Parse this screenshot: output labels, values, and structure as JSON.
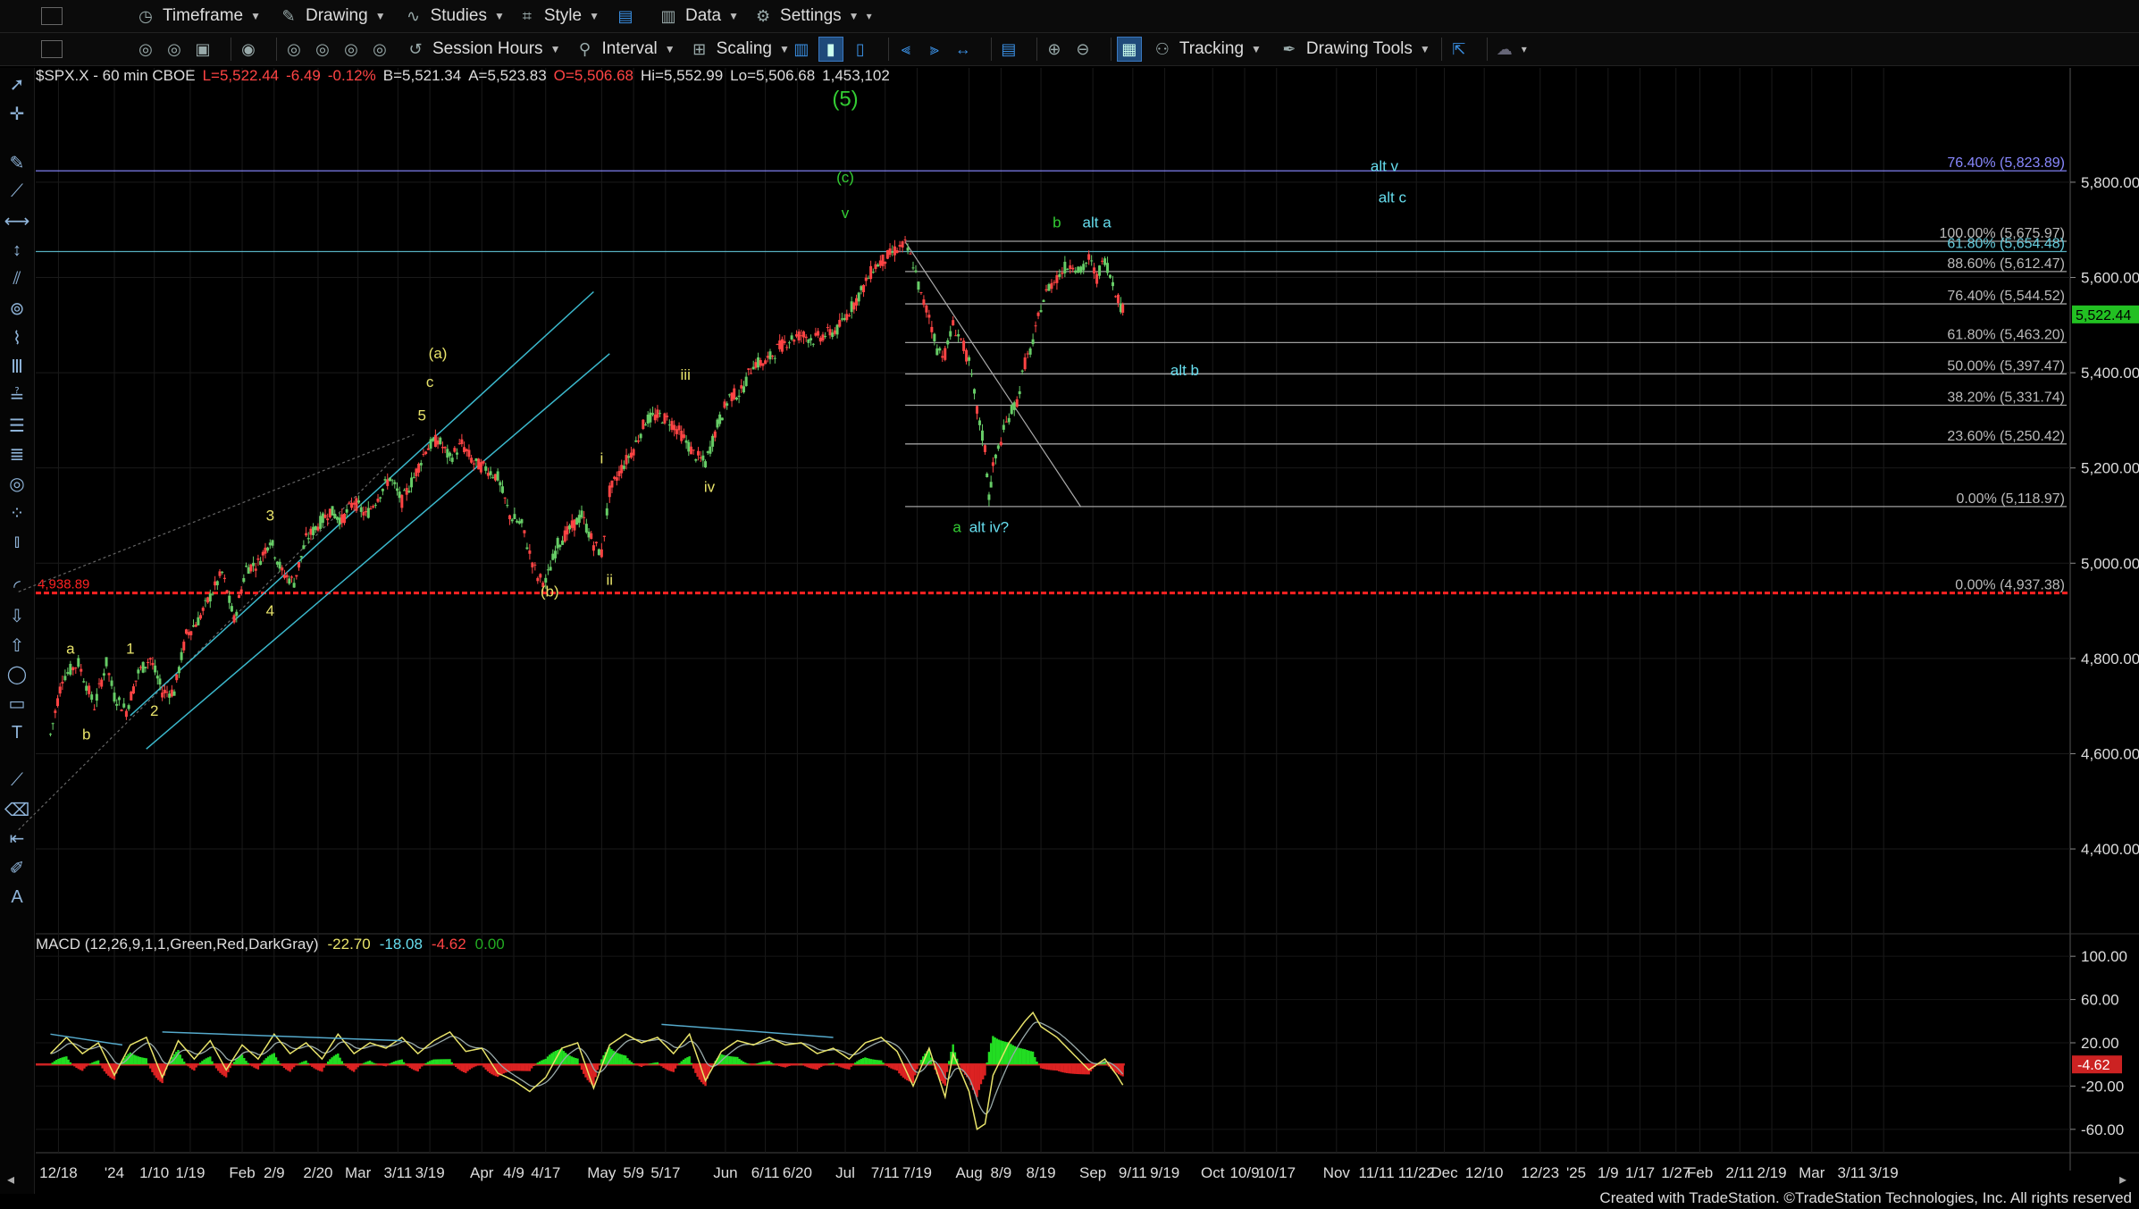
{
  "toolbar": {
    "timeframe": "Timeframe",
    "drawing": "Drawing",
    "studies": "Studies",
    "style": "Style",
    "data": "Data",
    "settings": "Settings",
    "session_hours": "Session Hours",
    "interval": "Interval",
    "scaling": "Scaling",
    "tracking": "Tracking",
    "drawing_tools": "Drawing Tools"
  },
  "colors": {
    "background": "#000000",
    "candle_up": "#66cc66",
    "candle_down": "#ff4444",
    "wave_yellow": "#e8e36a",
    "wave_green": "#33cc33",
    "wave_cyan": "#66ddee",
    "support_red": "#ff2222",
    "fib_gray": "#bbbbbb",
    "price_badge": "#22c022",
    "macd_pos": "#22dd22",
    "macd_neg": "#dd2222"
  },
  "chart_data": [
    {
      "type": "candlestick",
      "header": {
        "symbol": "$SPX.X - 60 min  CBOE",
        "last": "L=5,522.44",
        "change": "-6.49",
        "change_pct": "-0.12%",
        "bid": "B=5,521.34",
        "ask": "A=5,523.83",
        "open": "O=5,506.68",
        "high": "Hi=5,552.99",
        "low": "Lo=5,506.68",
        "volume": "1,453,102"
      },
      "y_ticks": [
        {
          "value": 5800,
          "label": "5,800.00"
        },
        {
          "value": 5600,
          "label": "5,600.00"
        },
        {
          "value": 5400,
          "label": "5,400.00"
        },
        {
          "value": 5200,
          "label": "5,200.00"
        },
        {
          "value": 5000,
          "label": "5,000.00"
        },
        {
          "value": 4800,
          "label": "4,800.00"
        },
        {
          "value": 4600,
          "label": "4,600.00"
        },
        {
          "value": 4400,
          "label": "4,400.00"
        }
      ],
      "ylim": [
        4250,
        6040
      ],
      "x_ticks": [
        {
          "d": -14,
          "label": "12/18"
        },
        {
          "d": 0,
          "label": "'24"
        },
        {
          "d": 10,
          "label": "1/10"
        },
        {
          "d": 19,
          "label": "1/19"
        },
        {
          "d": 32,
          "label": "Feb"
        },
        {
          "d": 40,
          "label": "2/9"
        },
        {
          "d": 51,
          "label": "2/20"
        },
        {
          "d": 61,
          "label": "Mar"
        },
        {
          "d": 71,
          "label": "3/11"
        },
        {
          "d": 79,
          "label": "3/19"
        },
        {
          "d": 92,
          "label": "Apr"
        },
        {
          "d": 100,
          "label": "4/9"
        },
        {
          "d": 108,
          "label": "4/17"
        },
        {
          "d": 122,
          "label": "May"
        },
        {
          "d": 130,
          "label": "5/9"
        },
        {
          "d": 138,
          "label": "5/17"
        },
        {
          "d": 153,
          "label": "Jun"
        },
        {
          "d": 163,
          "label": "6/11"
        },
        {
          "d": 171,
          "label": "6/20"
        },
        {
          "d": 183,
          "label": "Jul"
        },
        {
          "d": 193,
          "label": "7/11"
        },
        {
          "d": 201,
          "label": "7/19"
        },
        {
          "d": 214,
          "label": "Aug"
        },
        {
          "d": 222,
          "label": "8/9"
        },
        {
          "d": 232,
          "label": "8/19"
        },
        {
          "d": 245,
          "label": "Sep"
        },
        {
          "d": 255,
          "label": "9/11"
        },
        {
          "d": 263,
          "label": "9/19"
        },
        {
          "d": 275,
          "label": "Oct"
        },
        {
          "d": 283,
          "label": "10/9"
        },
        {
          "d": 291,
          "label": "10/17"
        },
        {
          "d": 306,
          "label": "Nov"
        },
        {
          "d": 316,
          "label": "11/11"
        },
        {
          "d": 326,
          "label": "11/22"
        },
        {
          "d": 333,
          "label": "Dec"
        },
        {
          "d": 343,
          "label": "12/10"
        },
        {
          "d": 357,
          "label": "12/23"
        },
        {
          "d": 366,
          "label": "'25"
        },
        {
          "d": 374,
          "label": "1/9"
        },
        {
          "d": 382,
          "label": "1/17"
        },
        {
          "d": 391,
          "label": "1/27"
        },
        {
          "d": 397,
          "label": "Feb"
        },
        {
          "d": 407,
          "label": "2/11"
        },
        {
          "d": 415,
          "label": "2/19"
        },
        {
          "d": 425,
          "label": "Mar"
        },
        {
          "d": 435,
          "label": "3/11"
        },
        {
          "d": 443,
          "label": "3/19"
        }
      ],
      "price_path": [
        [
          -16,
          4640
        ],
        [
          -13,
          4760
        ],
        [
          -9,
          4790
        ],
        [
          -5,
          4700
        ],
        [
          -2,
          4790
        ],
        [
          0,
          4720
        ],
        [
          3,
          4690
        ],
        [
          6,
          4770
        ],
        [
          9,
          4800
        ],
        [
          12,
          4730
        ],
        [
          15,
          4730
        ],
        [
          18,
          4850
        ],
        [
          21,
          4880
        ],
        [
          24,
          4930
        ],
        [
          27,
          4980
        ],
        [
          30,
          4880
        ],
        [
          33,
          4990
        ],
        [
          36,
          5000
        ],
        [
          39,
          5050
        ],
        [
          42,
          4980
        ],
        [
          45,
          4960
        ],
        [
          48,
          5050
        ],
        [
          51,
          5080
        ],
        [
          54,
          5110
        ],
        [
          57,
          5090
        ],
        [
          60,
          5130
        ],
        [
          63,
          5100
        ],
        [
          66,
          5140
        ],
        [
          69,
          5180
        ],
        [
          72,
          5130
        ],
        [
          75,
          5180
        ],
        [
          78,
          5240
        ],
        [
          81,
          5260
        ],
        [
          84,
          5220
        ],
        [
          87,
          5250
        ],
        [
          90,
          5210
        ],
        [
          93,
          5200
        ],
        [
          96,
          5180
        ],
        [
          99,
          5100
        ],
        [
          102,
          5080
        ],
        [
          104,
          5020
        ],
        [
          106,
          4970
        ],
        [
          108,
          4960
        ],
        [
          111,
          5040
        ],
        [
          114,
          5070
        ],
        [
          117,
          5100
        ],
        [
          120,
          5040
        ],
        [
          122,
          5020
        ],
        [
          124,
          5150
        ],
        [
          127,
          5200
        ],
        [
          130,
          5240
        ],
        [
          133,
          5300
        ],
        [
          136,
          5310
        ],
        [
          139,
          5300
        ],
        [
          142,
          5270
        ],
        [
          145,
          5230
        ],
        [
          148,
          5210
        ],
        [
          151,
          5290
        ],
        [
          154,
          5350
        ],
        [
          157,
          5360
        ],
        [
          160,
          5420
        ],
        [
          163,
          5420
        ],
        [
          166,
          5450
        ],
        [
          169,
          5470
        ],
        [
          172,
          5480
        ],
        [
          175,
          5470
        ],
        [
          178,
          5480
        ],
        [
          181,
          5490
        ],
        [
          184,
          5530
        ],
        [
          187,
          5570
        ],
        [
          190,
          5620
        ],
        [
          193,
          5640
        ],
        [
          196,
          5660
        ],
        [
          198,
          5668
        ],
        [
          200,
          5630
        ],
        [
          202,
          5560
        ],
        [
          204,
          5520
        ],
        [
          206,
          5450
        ],
        [
          208,
          5440
        ],
        [
          210,
          5500
        ],
        [
          212,
          5470
        ],
        [
          214,
          5420
        ],
        [
          216,
          5320
        ],
        [
          218,
          5240
        ],
        [
          219,
          5140
        ],
        [
          220,
          5200
        ],
        [
          222,
          5260
        ],
        [
          224,
          5310
        ],
        [
          226,
          5340
        ],
        [
          228,
          5420
        ],
        [
          230,
          5460
        ],
        [
          232,
          5540
        ],
        [
          234,
          5580
        ],
        [
          236,
          5600
        ],
        [
          238,
          5620
        ],
        [
          240,
          5630
        ],
        [
          242,
          5610
        ],
        [
          244,
          5640
        ],
        [
          246,
          5600
        ],
        [
          248,
          5640
        ],
        [
          250,
          5590
        ],
        [
          252,
          5540
        ],
        [
          253,
          5522
        ]
      ],
      "current_price": {
        "value": 5522.44,
        "label": "5,522.44"
      },
      "support_line": {
        "value": 4937.38,
        "label": "4,938.89"
      },
      "fib_levels": [
        {
          "value": 5823.89,
          "label": "76.40% (5,823.89)",
          "color": "#8888ff"
        },
        {
          "value": 5675.97,
          "label": "100.00% (5,675.97)",
          "color": "#bbbbbb"
        },
        {
          "value": 5654.48,
          "label": "61.80% (5,654.48)",
          "color": "#66ccdd"
        },
        {
          "value": 5612.47,
          "label": "88.60% (5,612.47)",
          "color": "#bbbbbb"
        },
        {
          "value": 5544.52,
          "label": "76.40% (5,544.52)",
          "color": "#bbbbbb"
        },
        {
          "value": 5463.2,
          "label": "61.80% (5,463.20)",
          "color": "#bbbbbb"
        },
        {
          "value": 5397.47,
          "label": "50.00% (5,397.47)",
          "color": "#bbbbbb"
        },
        {
          "value": 5331.74,
          "label": "38.20% (5,331.74)",
          "color": "#bbbbbb"
        },
        {
          "value": 5250.42,
          "label": "23.60% (5,250.42)",
          "color": "#bbbbbb"
        },
        {
          "value": 5118.97,
          "label": "0.00% (5,118.97)",
          "color": "#bbbbbb"
        },
        {
          "value": 4937.38,
          "label": "0.00% (4,937.38)",
          "color": "#bbbbbb"
        }
      ],
      "wave_labels": [
        {
          "d": 183,
          "v": 5960,
          "text": "(5)",
          "color": "green",
          "big": true
        },
        {
          "d": 183,
          "v": 5800,
          "text": "(c)",
          "color": "green"
        },
        {
          "d": 183,
          "v": 5725,
          "text": "v",
          "color": "green"
        },
        {
          "d": 236,
          "v": 5705,
          "text": "b",
          "color": "green"
        },
        {
          "d": 211,
          "v": 5065,
          "text": "a",
          "color": "green"
        },
        {
          "d": 246,
          "v": 5705,
          "text": "alt a",
          "color": "cyan"
        },
        {
          "d": 318,
          "v": 5823,
          "text": "alt v",
          "color": "cyan"
        },
        {
          "d": 320,
          "v": 5758,
          "text": "alt c",
          "color": "cyan"
        },
        {
          "d": 268,
          "v": 5395,
          "text": "alt b",
          "color": "cyan"
        },
        {
          "d": 219,
          "v": 5065,
          "text": "alt iv?",
          "color": "cyan"
        },
        {
          "d": 81,
          "v": 5430,
          "text": "(a)",
          "color": "yellow"
        },
        {
          "d": 79,
          "v": 5370,
          "text": "c",
          "color": "yellow"
        },
        {
          "d": 77,
          "v": 5300,
          "text": "5",
          "color": "yellow"
        },
        {
          "d": 39,
          "v": 5090,
          "text": "3",
          "color": "yellow"
        },
        {
          "d": 39,
          "v": 4890,
          "text": "4",
          "color": "yellow"
        },
        {
          "d": 4,
          "v": 4810,
          "text": "1",
          "color": "yellow"
        },
        {
          "d": 10,
          "v": 4680,
          "text": "2",
          "color": "yellow"
        },
        {
          "d": -11,
          "v": 4810,
          "text": "a",
          "color": "yellow"
        },
        {
          "d": -7,
          "v": 4630,
          "text": "b",
          "color": "yellow"
        },
        {
          "d": 109,
          "v": 4930,
          "text": "(b)",
          "color": "yellow"
        },
        {
          "d": 122,
          "v": 5210,
          "text": "i",
          "color": "yellow"
        },
        {
          "d": 124,
          "v": 4955,
          "text": "ii",
          "color": "yellow"
        },
        {
          "d": 143,
          "v": 5385,
          "text": "iii",
          "color": "yellow"
        },
        {
          "d": 149,
          "v": 5150,
          "text": "iv",
          "color": "yellow"
        }
      ]
    },
    {
      "type": "line",
      "title": "MACD (12,26,9,1,1,Green,Red,DarkGray)",
      "readouts": [
        {
          "text": "-22.70",
          "color": "#e8e36a"
        },
        {
          "text": "-18.08",
          "color": "#66ddee"
        },
        {
          "text": "-4.62",
          "color": "#ff4444"
        },
        {
          "text": "0.00",
          "color": "#22aa22"
        }
      ],
      "y_ticks": [
        {
          "value": 100,
          "label": "100.00"
        },
        {
          "value": 60,
          "label": "60.00"
        },
        {
          "value": 20,
          "label": "20.00"
        },
        {
          "value": -20,
          "label": "-20.00"
        },
        {
          "value": -60,
          "label": "-60.00"
        }
      ],
      "ylim": [
        -75,
        115
      ],
      "current_value": {
        "value": 0,
        "label": "-4.62"
      },
      "macd_path": [
        [
          -16,
          10
        ],
        [
          -12,
          25
        ],
        [
          -8,
          10
        ],
        [
          -4,
          20
        ],
        [
          0,
          -10
        ],
        [
          4,
          18
        ],
        [
          8,
          25
        ],
        [
          12,
          -12
        ],
        [
          16,
          22
        ],
        [
          20,
          5
        ],
        [
          24,
          22
        ],
        [
          28,
          -5
        ],
        [
          32,
          18
        ],
        [
          36,
          5
        ],
        [
          40,
          28
        ],
        [
          44,
          10
        ],
        [
          48,
          20
        ],
        [
          52,
          5
        ],
        [
          56,
          28
        ],
        [
          60,
          10
        ],
        [
          64,
          20
        ],
        [
          68,
          15
        ],
        [
          72,
          25
        ],
        [
          76,
          10
        ],
        [
          80,
          22
        ],
        [
          84,
          30
        ],
        [
          88,
          12
        ],
        [
          92,
          15
        ],
        [
          96,
          -8
        ],
        [
          100,
          -15
        ],
        [
          104,
          -25
        ],
        [
          108,
          -12
        ],
        [
          112,
          15
        ],
        [
          116,
          20
        ],
        [
          120,
          -22
        ],
        [
          124,
          18
        ],
        [
          128,
          28
        ],
        [
          132,
          20
        ],
        [
          136,
          25
        ],
        [
          140,
          10
        ],
        [
          144,
          28
        ],
        [
          148,
          -15
        ],
        [
          152,
          12
        ],
        [
          156,
          22
        ],
        [
          160,
          18
        ],
        [
          164,
          25
        ],
        [
          168,
          18
        ],
        [
          172,
          20
        ],
        [
          176,
          10
        ],
        [
          180,
          15
        ],
        [
          184,
          5
        ],
        [
          188,
          20
        ],
        [
          192,
          25
        ],
        [
          196,
          12
        ],
        [
          200,
          -20
        ],
        [
          204,
          15
        ],
        [
          208,
          -30
        ],
        [
          210,
          10
        ],
        [
          214,
          -25
        ],
        [
          216,
          -60
        ],
        [
          218,
          -55
        ],
        [
          220,
          -10
        ],
        [
          224,
          20
        ],
        [
          228,
          40
        ],
        [
          230,
          48
        ],
        [
          232,
          35
        ],
        [
          236,
          25
        ],
        [
          240,
          10
        ],
        [
          244,
          -5
        ],
        [
          248,
          5
        ],
        [
          251,
          -10
        ],
        [
          253,
          -22
        ]
      ],
      "trendlines": [
        {
          "from": [
            -16,
            28
          ],
          "to": [
            2,
            18
          ]
        },
        {
          "from": [
            12,
            30
          ],
          "to": [
            72,
            22
          ]
        },
        {
          "from": [
            137,
            37
          ],
          "to": [
            180,
            25
          ]
        }
      ]
    }
  ],
  "footer": "Created with TradeStation. ©TradeStation Technologies, Inc. All rights reserved"
}
